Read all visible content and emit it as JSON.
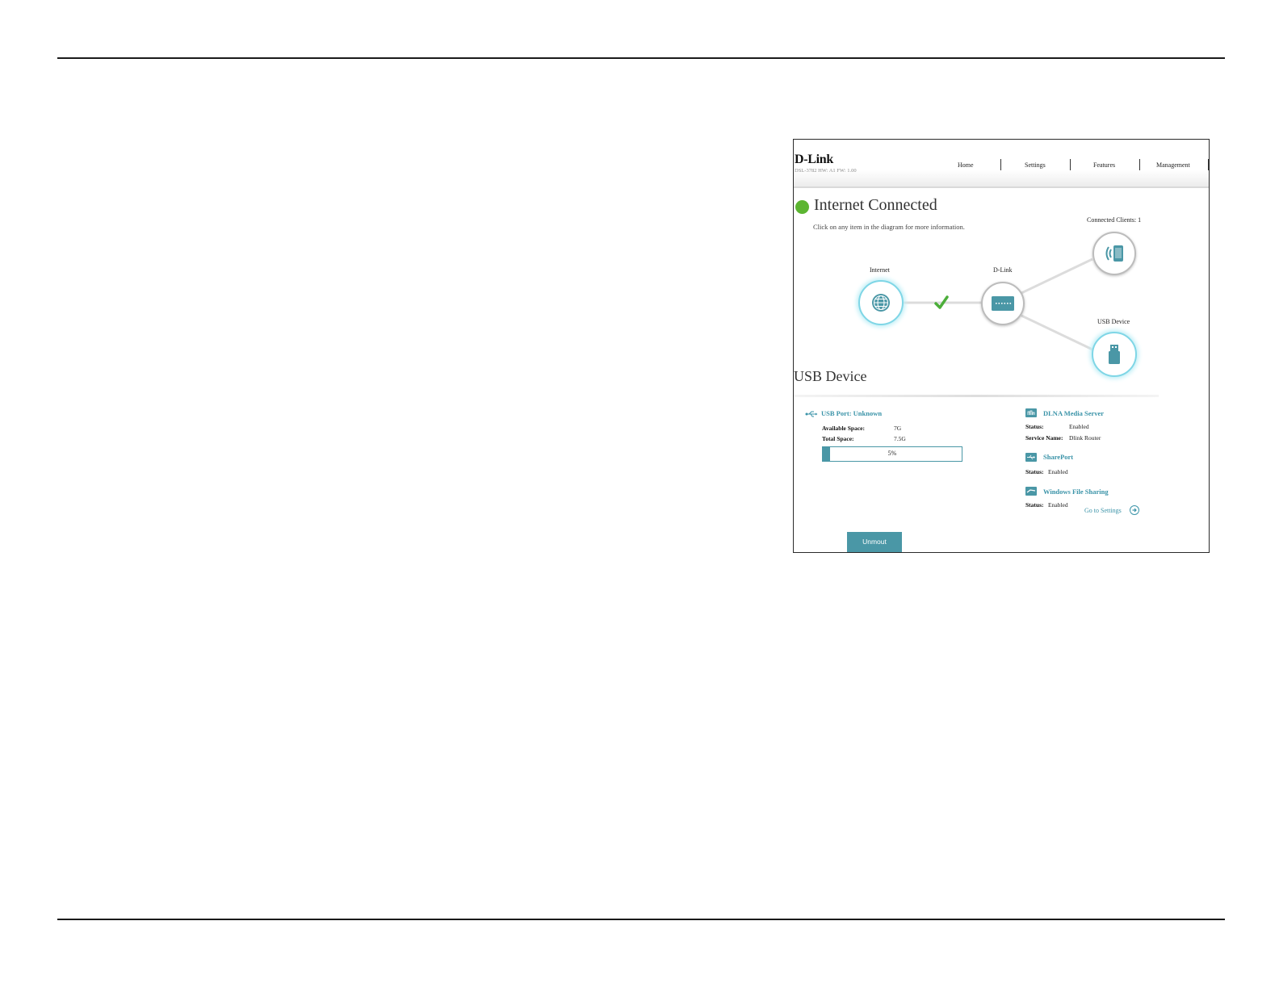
{
  "header": {
    "logo": "D-Link",
    "model_info": "DSL-3782  HW: A1  FW: 1.00",
    "nav": [
      "Home",
      "Settings",
      "Features",
      "Management"
    ]
  },
  "status": {
    "title": "Internet Connected",
    "hint": "Click on any item in the diagram for more information.",
    "color": "#5cb531"
  },
  "diagram": {
    "internet_label": "Internet",
    "router_label": "D-Link",
    "clients_label": "Connected Clients: 1",
    "usb_label": "USB Device"
  },
  "usb": {
    "title": "USB Device",
    "port_label": "USB Port: Unknown",
    "available_key": "Available Space:",
    "available_val": "7G",
    "total_key": "Total Space:",
    "total_val": "7.5G",
    "usage_text": "5%",
    "usage_fraction": 0.05
  },
  "services": {
    "dlna_title": "DLNA Media Server",
    "dlna_status_key": "Status:",
    "dlna_status_val": "Enabled",
    "dlna_service_key": "Service Name:",
    "dlna_service_val": "Dlink Router",
    "shareport_title": "SharePort",
    "shareport_status_key": "Status:",
    "shareport_status_val": "Enabled",
    "wfs_title": "Windows File Sharing",
    "wfs_status_key": "Status:",
    "wfs_status_val": "Enabled",
    "goto_label": "Go to Settings"
  },
  "actions": {
    "unmount_label": "Unmout"
  },
  "colors": {
    "accent": "#4a97a6",
    "link": "#3a93a8",
    "ok": "#5cb531"
  }
}
